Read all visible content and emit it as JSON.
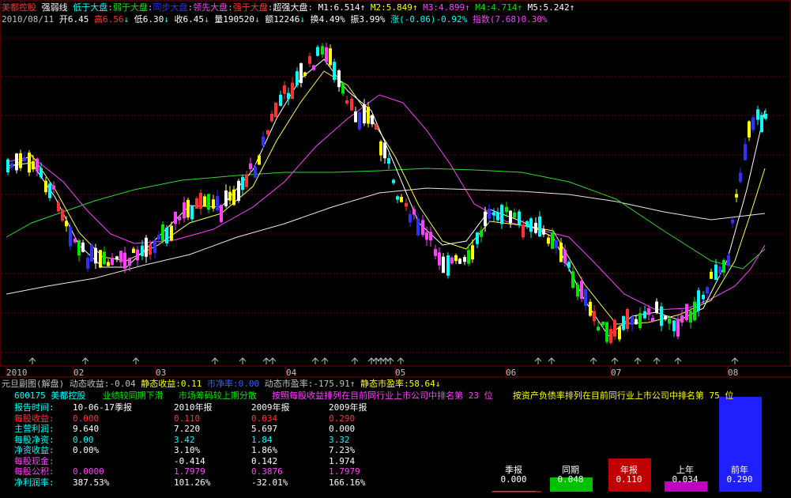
{
  "header": {
    "stock_name": "美都控股",
    "indicator": "强弱线",
    "legend": [
      {
        "text": "低于大盘",
        "color": "#00ffff"
      },
      {
        "text": "弱于大盘",
        "color": "#00e600"
      },
      {
        "text": "同步大盘",
        "color": "#3030ff"
      },
      {
        "text": "领先大盘",
        "color": "#ff40ff"
      },
      {
        "text": "强于大盘",
        "color": "#ff3232"
      },
      {
        "text": "超强大盘",
        "color": "#ffffff"
      }
    ],
    "mas": [
      {
        "label": "M1:",
        "value": "6.514",
        "arrow": "↑",
        "color": "#ffffff"
      },
      {
        "label": "M2:",
        "value": "5.849",
        "arrow": "↑",
        "color": "#ffff00"
      },
      {
        "label": "M3:",
        "value": "4.899",
        "arrow": "↑",
        "color": "#ff40ff"
      },
      {
        "label": "M4:",
        "value": "4.714",
        "arrow": "↑",
        "color": "#00e600"
      },
      {
        "label": "M5:",
        "value": "5.242",
        "arrow": "↑",
        "color": "#ffffff"
      }
    ]
  },
  "quote": {
    "date": "2010/08/11",
    "open_label": "开",
    "open": "6.45",
    "high_label": "高",
    "high": "6.56",
    "low_label": "低",
    "low": "6.30",
    "close_label": "收",
    "close": "6.45",
    "vol_label": "量",
    "vol": "190520",
    "amt_label": "额",
    "amt": "12246",
    "turn_label": "换",
    "turn": "4.49%",
    "amp_label": "振",
    "amp": "3.99%",
    "chg_label": "涨",
    "chg": "(-0.06)-0.92%",
    "idx_label": "指数",
    "idx": "(7.68)0.30%"
  },
  "xaxis": {
    "labels": [
      "2010",
      "02",
      "03",
      "04",
      "05",
      "06",
      "07",
      "08"
    ],
    "colors": {
      "text": "#c0c0c0",
      "grid": "#800000"
    }
  },
  "info_line": {
    "title": "元旦副图(解盘)",
    "items": [
      {
        "label": "动态收益:",
        "value": "-0.04",
        "color": "#c0c0c0"
      },
      {
        "label": "静态收益:",
        "value": "0.11",
        "color": "#ffff00"
      },
      {
        "label": "市净率:",
        "value": "0.00",
        "color": "#3060ff"
      },
      {
        "label": "动态市盈率:",
        "value": "-175.91↑",
        "color": "#c0c0c0"
      },
      {
        "label": "静态市盈率:",
        "value": "58.64↓",
        "color": "#ffff00"
      }
    ]
  },
  "stock_line": {
    "code": "600175",
    "name": "美都控股",
    "t1": "业绩较同期下滑",
    "t2": "市场筹码较上期分散",
    "t3": "按照每股收益排列在目前同行业上市公司中排名第 23 位",
    "t4": "按资产负债率排列在目前同行业上市公司中排名第 75 位"
  },
  "fin_table": {
    "header": [
      "报告时间:",
      "10-06-17季报",
      "2010年报",
      "2009年报",
      "2009年报"
    ],
    "rows": [
      {
        "label": "每股收益:",
        "cells": [
          "0.000",
          "0.110",
          "0.034",
          "0.290"
        ],
        "label_color": "#ff3232",
        "value_color": "#ff3232"
      },
      {
        "label": "主营利润:",
        "cells": [
          "9.640",
          "7.220",
          "5.697",
          "0.000"
        ],
        "label_color": "#00ffff",
        "value_color": "#ffffff"
      },
      {
        "label": "每股净资:",
        "cells": [
          "0.00",
          "3.42",
          "1.84",
          "3.32"
        ],
        "label_color": "#00ffff",
        "value_color": "#00ffff"
      },
      {
        "label": "净资收益:",
        "cells": [
          "0.00%",
          "3.10%",
          "1.86%",
          "7.23%"
        ],
        "label_color": "#00ffff",
        "value_color": "#ffffff"
      },
      {
        "label": "每股现金:",
        "cells": [
          "",
          "-0.414",
          "0.142",
          "1.974"
        ],
        "label_color": "#ff40ff",
        "value_color": "#ffffff"
      },
      {
        "label": "每股公积:",
        "cells": [
          "0.0000",
          "1.7979",
          "0.3876",
          "1.7979"
        ],
        "label_color": "#ff40ff",
        "value_color": "#ff40ff"
      },
      {
        "label": "净利润率:",
        "cells": [
          "387.53%",
          "101.26%",
          "-32.01%",
          "166.16%"
        ],
        "label_color": "#00ffff",
        "value_color": "#ffffff"
      }
    ]
  },
  "mini_bars": [
    {
      "name": "季报",
      "value": "0.000",
      "color": "#ff3232",
      "level": 0.0
    },
    {
      "name": "同期",
      "value": "0.048",
      "color": "#00c000",
      "level": 0.15
    },
    {
      "name": "年报",
      "value": "0.110",
      "color": "#c00000",
      "level": 0.35
    },
    {
      "name": "上年",
      "value": "0.034",
      "color": "#c000c0",
      "level": 0.11
    },
    {
      "name": "前年",
      "value": "0.290",
      "color": "#2020ff",
      "level": 1.0
    }
  ]
}
